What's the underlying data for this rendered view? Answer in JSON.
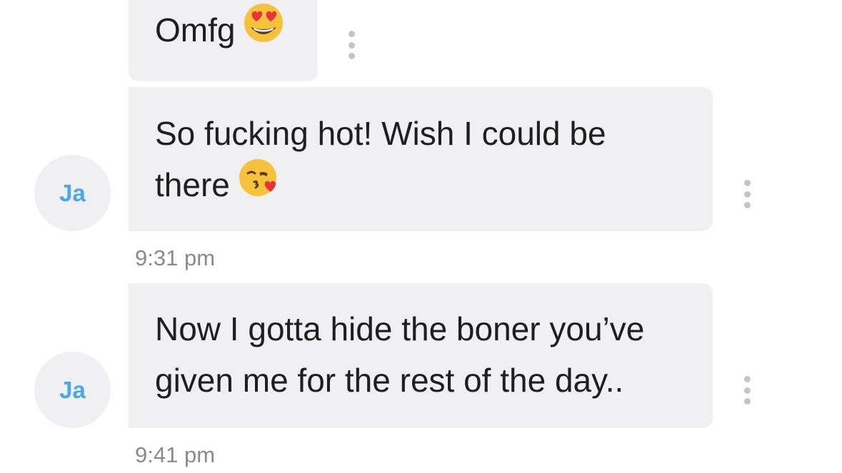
{
  "messages": [
    {
      "text": "Omfg",
      "emoji": "heart-eyes-emoji",
      "timestamp": null
    },
    {
      "lines": [
        "So fucking hot! Wish I could be",
        "there"
      ],
      "emoji": "kissing-heart-emoji",
      "avatar_initials": "Ja",
      "timestamp": "9:31 pm"
    },
    {
      "lines": [
        "Now I gotta hide the boner you’ve",
        "given me for the rest of the day.."
      ],
      "avatar_initials": "Ja",
      "timestamp": "9:41 pm"
    }
  ],
  "colors": {
    "bubble": "#f0f0f2",
    "avatar_text": "#4aa8e8",
    "timestamp": "#8a8a8e",
    "menu_dots": "#c4c4c8"
  }
}
